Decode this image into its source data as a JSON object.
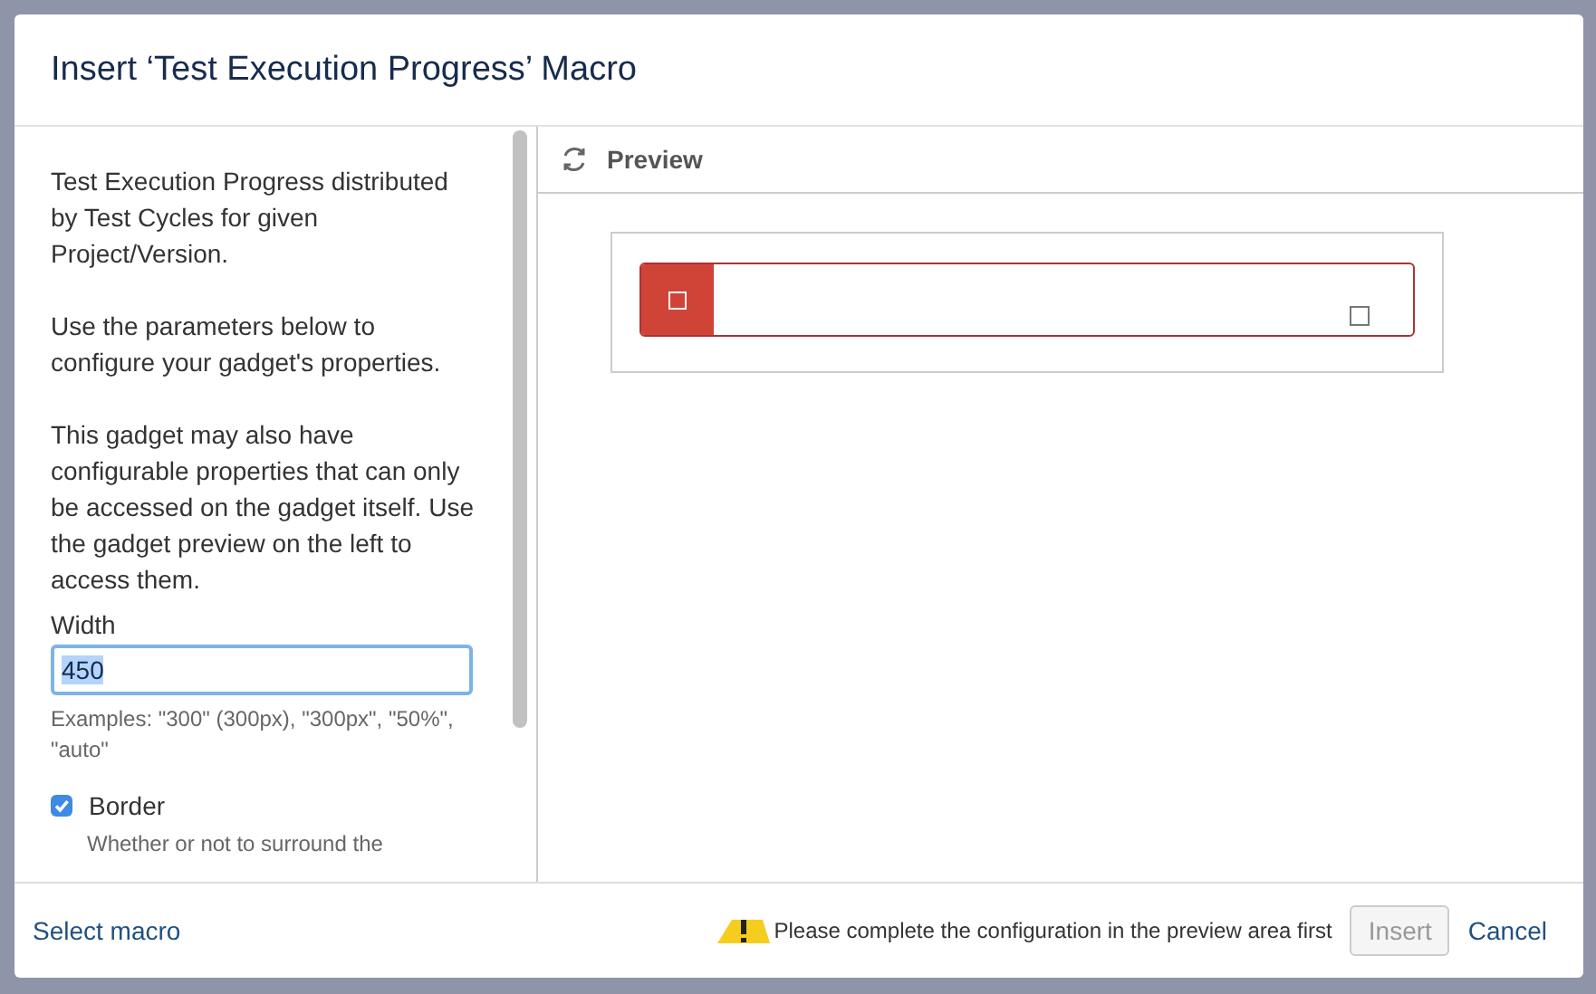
{
  "dialog": {
    "title": "Insert ‘Test Execution Progress’ Macro"
  },
  "parameters": {
    "paragraphs": [
      "Test Execution Progress distributed by Test Cycles for given Project/Version.",
      "Use the parameters below to configure your gadget's properties.",
      "This gadget may also have configurable properties that can only be accessed on the gadget itself. Use the gadget preview on the left to access them."
    ],
    "width": {
      "label": "Width",
      "value": "450",
      "hint": "Examples: \"300\" (300px), \"300px\", \"50%\", \"auto\""
    },
    "border": {
      "label": "Border",
      "checked": true,
      "description": "Whether or not to surround the"
    }
  },
  "preview": {
    "title": "Preview"
  },
  "footer": {
    "link": "Select macro",
    "warning": "Please complete the configuration in the preview area first",
    "buttons": [
      {
        "label": "Insert",
        "kind": "button",
        "disabled": true
      },
      {
        "label": "Cancel",
        "kind": "link",
        "disabled": false
      }
    ]
  }
}
